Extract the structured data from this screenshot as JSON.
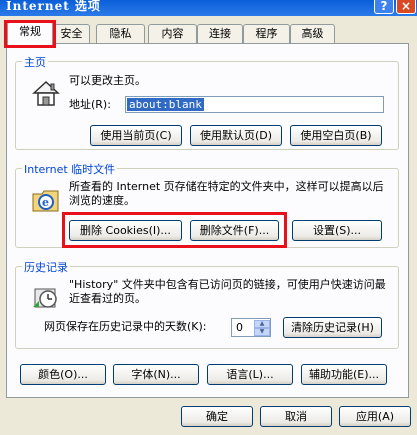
{
  "window": {
    "title": "Internet 选项",
    "help_icon": "?",
    "close_icon": "×"
  },
  "tabs": [
    {
      "label": "常规",
      "active": true
    },
    {
      "label": "安全"
    },
    {
      "label": "隐私"
    },
    {
      "label": "内容"
    },
    {
      "label": "连接"
    },
    {
      "label": "程序"
    },
    {
      "label": "高级"
    }
  ],
  "homepage": {
    "title": "主页",
    "description": "可以更改主页。",
    "address_label": "地址(R):",
    "address_value": "about:blank",
    "use_current_label": "使用当前页(C)",
    "use_default_label": "使用默认页(D)",
    "use_blank_label": "使用空白页(B)",
    "icon": "house-icon"
  },
  "temp_files": {
    "title": "Internet 临时文件",
    "description": "所查看的 Internet 页存储在特定的文件夹中，这样可以提高以后浏览的速度。",
    "delete_cookies_label": "删除 Cookies(I)...",
    "delete_files_label": "删除文件(F)...",
    "settings_label": "设置(S)...",
    "icon": "ie-folder-icon"
  },
  "history": {
    "title": "历史记录",
    "description": "\"History\" 文件夹中包含有已访问页的链接，可使用户快速访问最近查看过的页。",
    "days_label": "网页保存在历史记录中的天数(K):",
    "days_value": "0",
    "clear_label": "清除历史记录(H)",
    "icon": "history-icon"
  },
  "bottom_buttons": {
    "colors_label": "颜色(O)...",
    "fonts_label": "字体(N)...",
    "languages_label": "语言(L)...",
    "accessibility_label": "辅助功能(E)..."
  },
  "dialog_buttons": {
    "ok_label": "确定",
    "cancel_label": "取消",
    "apply_label": "应用(A)"
  },
  "colors": {
    "highlight": "#e8101a",
    "group_title": "#0046d5",
    "titlebar": "#0a5fd8"
  }
}
